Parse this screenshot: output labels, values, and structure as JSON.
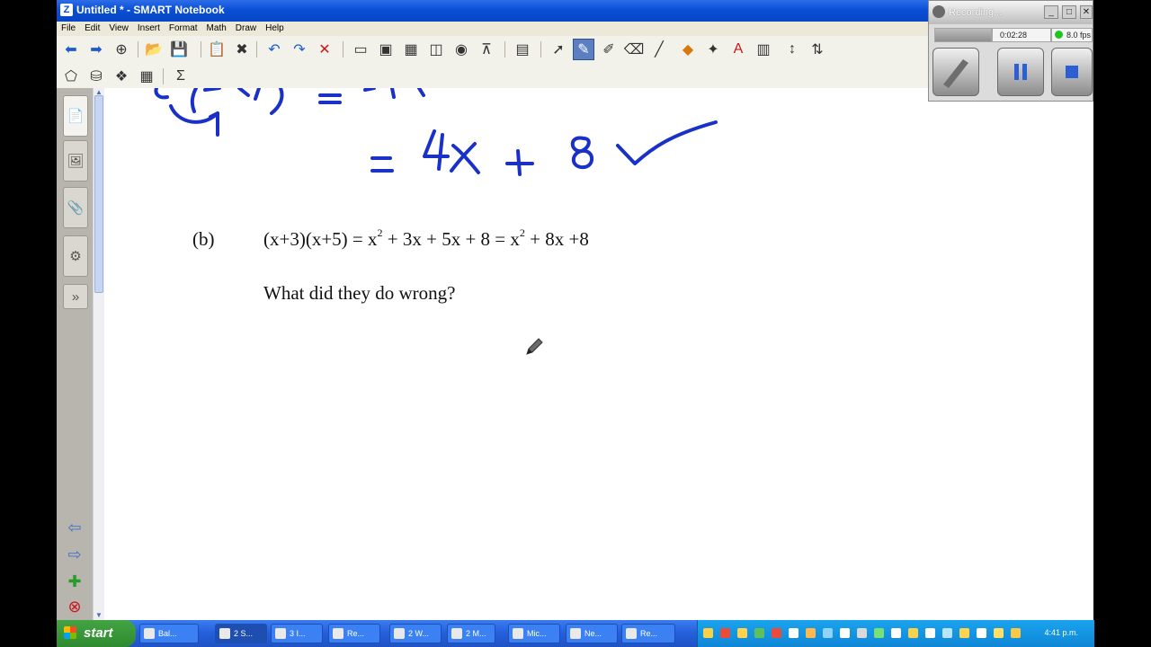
{
  "window": {
    "title": "Untitled * - SMART Notebook"
  },
  "menu": [
    "File",
    "Edit",
    "View",
    "Insert",
    "Format",
    "Math",
    "Draw",
    "Help"
  ],
  "toolbar": {
    "row1": [
      {
        "name": "back-icon",
        "glyph": "⬅",
        "style": "blue"
      },
      {
        "name": "forward-icon",
        "glyph": "➡",
        "style": "blue"
      },
      {
        "name": "add-page-icon",
        "glyph": "⊕",
        "style": ""
      },
      {
        "name": "open-icon",
        "glyph": "📂",
        "style": "orange"
      },
      {
        "name": "save-icon",
        "glyph": "💾",
        "style": "blue"
      },
      {
        "name": "paste-icon",
        "glyph": "📋",
        "style": ""
      },
      {
        "name": "delete-page-icon",
        "glyph": "✖",
        "style": ""
      },
      {
        "name": "undo-icon",
        "glyph": "↶",
        "style": "blue"
      },
      {
        "name": "redo-icon",
        "glyph": "↷",
        "style": "blue"
      },
      {
        "name": "delete-icon",
        "glyph": "✕",
        "style": "red"
      },
      {
        "name": "screen-shade-icon",
        "glyph": "▭",
        "style": ""
      },
      {
        "name": "full-screen-icon",
        "glyph": "▣",
        "style": ""
      },
      {
        "name": "transparent-bg-icon",
        "glyph": "▦",
        "style": ""
      },
      {
        "name": "dual-display-icon",
        "glyph": "◫",
        "style": ""
      },
      {
        "name": "capture-icon",
        "glyph": "◉",
        "style": ""
      },
      {
        "name": "document-camera-icon",
        "glyph": "⊼",
        "style": ""
      },
      {
        "name": "table-icon",
        "glyph": "▤",
        "style": ""
      },
      {
        "name": "select-icon",
        "glyph": "➚",
        "style": ""
      },
      {
        "name": "pen-icon",
        "glyph": "✎",
        "style": "active"
      },
      {
        "name": "creative-pen-icon",
        "glyph": "✐",
        "style": ""
      },
      {
        "name": "eraser-icon",
        "glyph": "⌫",
        "style": ""
      },
      {
        "name": "line-icon",
        "glyph": "╱",
        "style": ""
      },
      {
        "name": "shapes-icon",
        "glyph": "◆",
        "style": "orange"
      },
      {
        "name": "magic-pen-icon",
        "glyph": "✦",
        "style": ""
      },
      {
        "name": "text-icon",
        "glyph": "A",
        "style": "red"
      },
      {
        "name": "fill-icon",
        "glyph": "▥",
        "style": ""
      },
      {
        "name": "properties-icon",
        "glyph": "↕",
        "style": ""
      },
      {
        "name": "move-toolbar-icon",
        "glyph": "⇅",
        "style": ""
      }
    ],
    "row2": [
      {
        "name": "shape-recognition-icon",
        "glyph": "⬠",
        "style": ""
      },
      {
        "name": "fill-bucket-icon",
        "glyph": "⛁",
        "style": ""
      },
      {
        "name": "gallery-icon",
        "glyph": "❖",
        "style": ""
      },
      {
        "name": "table-tools-icon",
        "glyph": "▦",
        "style": ""
      },
      {
        "name": "sigma-icon",
        "glyph": "Σ",
        "style": ""
      }
    ]
  },
  "sidebar": {
    "tabs": [
      {
        "name": "page-sorter-tab",
        "glyph": "📄"
      },
      {
        "name": "gallery-tab",
        "glyph": "🖼"
      },
      {
        "name": "attachments-tab",
        "glyph": "📎"
      },
      {
        "name": "properties-tab",
        "glyph": "⚙"
      },
      {
        "name": "collapse-tab",
        "glyph": "»"
      }
    ],
    "nav": [
      {
        "name": "previous-page-icon",
        "glyph": "⇦"
      },
      {
        "name": "next-page-icon",
        "glyph": "⇨"
      },
      {
        "name": "add-page-side-icon",
        "glyph": "✚"
      },
      {
        "name": "delete-page-side-icon",
        "glyph": "⊗"
      }
    ]
  },
  "page": {
    "handwriting_line2": "= 4x + 8 ✓",
    "part_label": "(b)",
    "equation_lhs": "(x+3)(x+5) = x",
    "exp1": "2",
    "equation_mid": " + 3x + 5x + 8 = x",
    "exp2": "2",
    "equation_rhs": " + 8x +8",
    "question": "What did they do wrong?"
  },
  "recorder": {
    "title": "Recording...",
    "elapsed": "0:02:28",
    "fps": "8.0 fps",
    "status_color": "#22c322"
  },
  "taskbar": {
    "start_label": "start",
    "tasks": [
      {
        "label": "Bal..."
      },
      {
        "label": "2 S..."
      },
      {
        "label": "3 I..."
      },
      {
        "label": "Re..."
      },
      {
        "label": "2 W..."
      },
      {
        "label": "2 M..."
      },
      {
        "label": "Mic..."
      },
      {
        "label": "Ne..."
      },
      {
        "label": "Re..."
      }
    ],
    "clock": "4:41 p.m."
  },
  "colors": {
    "ink": "#1a31c8",
    "titlebar": "#0a4fd6",
    "taskbar": "#245edb",
    "start": "#3c9a3c"
  }
}
